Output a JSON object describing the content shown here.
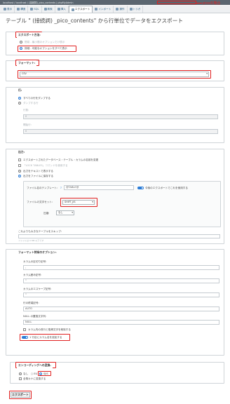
{
  "browser": {
    "bar_text": "localhost / localhost / (接続詞)_pico_contents | phpMyAdmin",
    "pico_label": "picoの場合"
  },
  "tabs": [
    {
      "label": "表示",
      "icon": "table-icon"
    },
    {
      "label": "構造",
      "icon": "structure-icon"
    },
    {
      "label": "SQL",
      "icon": "sql-icon"
    },
    {
      "label": "検索",
      "icon": "search-icon"
    },
    {
      "label": "挿入",
      "icon": "insert-icon"
    },
    {
      "label": "エクスポート",
      "icon": "export-icon"
    },
    {
      "label": "インポート",
      "icon": "import-icon"
    },
    {
      "label": "操作",
      "icon": "wrench-icon"
    },
    {
      "label": "トリガ",
      "icon": "trigger-icon"
    }
  ],
  "page_title": "テーブル \" (接続詞) _pico_contents\" から行単位でデータをエクスポート",
  "export_method": {
    "legend": "エクスポート方法:",
    "quick": "簡易 - 最小限のオプションだけ表示",
    "custom": "詳細 - 可能なオプションをすべて表示"
  },
  "format": {
    "legend": "フォーマット:",
    "value": "CSV"
  },
  "rows": {
    "legend": "行:",
    "dump_all": "すべての行をダンプする",
    "dump_some": "ダンプする行",
    "row_count_label": "行数:",
    "row_count_value": "0",
    "start_label": "開始行:",
    "start_value": "0"
  },
  "output": {
    "legend": "出力:",
    "rename": "エクスポートされたデータベース・テーブル・カラムの名前を変更",
    "lock": "「LOCK TABLES」コマンドを使用する",
    "as_text": "出力をテキストで表示する",
    "save_file": "出力をファイルに保存する",
    "template_label": "ファイル名のテンプレート:",
    "template_value": "@TABLE@",
    "remember": "今後のエクスポートでこれを使用する",
    "charset_label": "ファイルの文字セット:",
    "charset_value": "SHIFT_JIS",
    "compress_label": "圧縮:",
    "compress_value": "なし",
    "skip_tables": "これよりも大きなテーブルをスキップ:",
    "skip_hint": "ファイルは 0 MB 以下です"
  },
  "format_options": {
    "legend": "フォーマット特有のオプション:",
    "sep_label": "カラムの区切り記号:",
    "sep_value": ",",
    "enc_label": "カラム囲み記号:",
    "enc_value": "\"",
    "esc_label": "カラムのエスケープ記号:",
    "esc_value": "\"",
    "term_label": "行の終端記号:",
    "term_value": "AUTO",
    "null_label": "NULL の置換文字列:",
    "null_value": "NULL",
    "crlf": "カラム内の改行と復帰文字を削除する",
    "header": "1 行目にカラム名を追加する"
  },
  "encoding": {
    "legend": "エンコーディングへの変換:",
    "none": "なし",
    "sjis": "SJIS",
    "kana": "全角カナに変換する"
  },
  "submit_label": "エクスポート"
}
